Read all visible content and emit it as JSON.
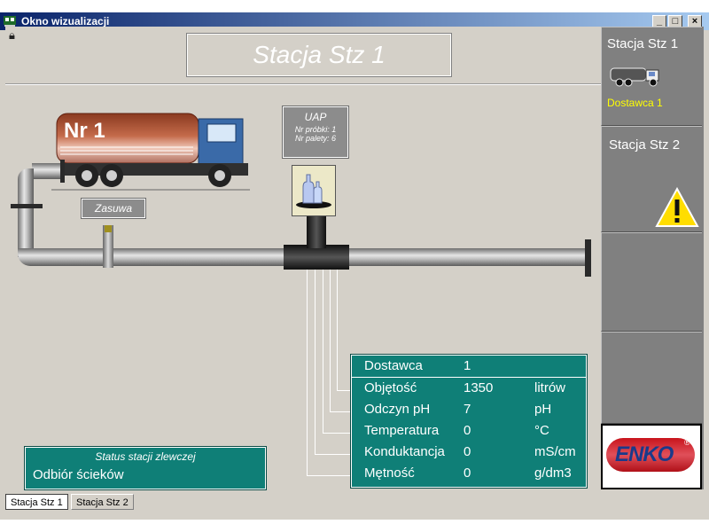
{
  "window": {
    "title": "Okno wizualizacji",
    "min": "_",
    "max": "□",
    "close": "×"
  },
  "station": {
    "title": "Stacja Stz 1"
  },
  "truck": {
    "label": "Nr 1"
  },
  "valve": {
    "label": "Zasuwa"
  },
  "uap": {
    "title": "UAP",
    "sample": "Nr próbki: 1",
    "pallet": "Nr palety: 6"
  },
  "data_panel": {
    "rows": [
      {
        "label": "Dostawca",
        "value": "1",
        "unit": ""
      },
      {
        "label": "Objętość",
        "value": "1350",
        "unit": "litrów"
      },
      {
        "label": "Odczyn pH",
        "value": "7",
        "unit": "pH"
      },
      {
        "label": "Temperatura",
        "value": "0",
        "unit": "°C"
      },
      {
        "label": "Konduktancja",
        "value": "0",
        "unit": "mS/cm"
      },
      {
        "label": "Mętność",
        "value": "0",
        "unit": "g/dm3"
      }
    ]
  },
  "status": {
    "title": "Status stacji zlewczej",
    "value": "Odbiór ścieków"
  },
  "sidebar": {
    "station1": {
      "title": "Stacja Stz 1",
      "supplier": "Dostawca 1"
    },
    "station2": {
      "title": "Stacja Stz 2"
    },
    "logo": "ENKO",
    "logo_mark": "®"
  },
  "tabs": [
    {
      "label": "Stacja Stz 1"
    },
    {
      "label": "Stacja Stz 2"
    }
  ],
  "colors": {
    "teal": "#0f7f77",
    "title_bar": "#0a246a",
    "warning": "#ffdd00",
    "supplier_text": "#ffff00"
  }
}
